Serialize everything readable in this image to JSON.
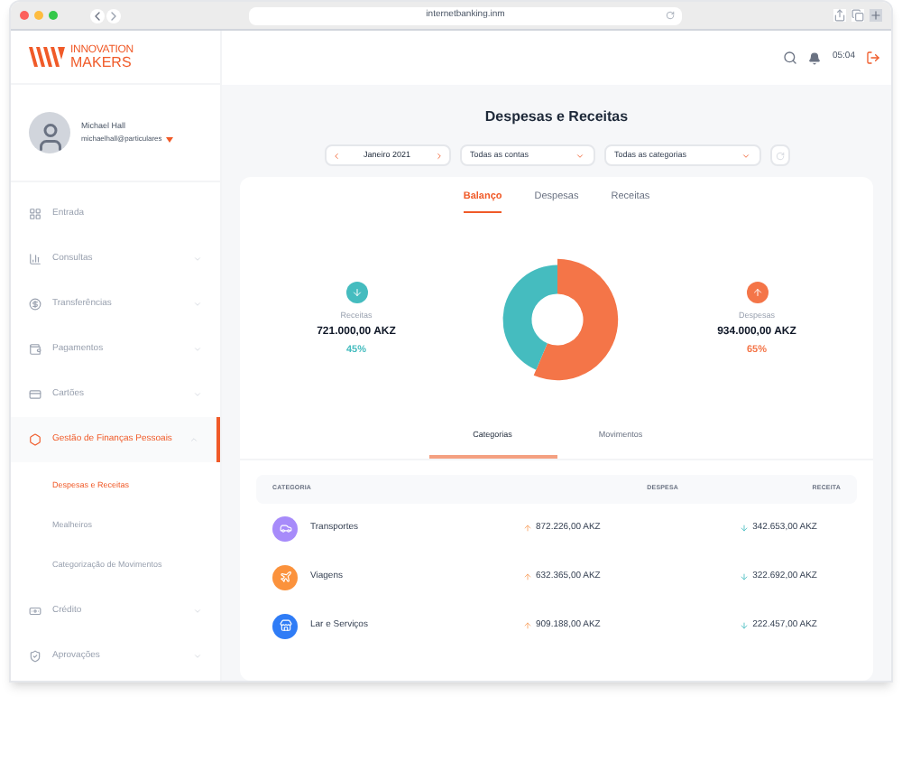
{
  "browser": {
    "url": "internetbanking.inm"
  },
  "brand": {
    "line_1": "INNOVATION",
    "line_2": "MAKERS"
  },
  "profile": {
    "name": "Michael Hall",
    "email": "michaelhall@particulares"
  },
  "sidebar": {
    "items": [
      {
        "label": "Entrada",
        "selected": false
      },
      {
        "label": "Consultas",
        "selected": false,
        "expanded": false
      },
      {
        "label": "Transferências",
        "selected": false,
        "expanded": false
      },
      {
        "label": "Pagamentos",
        "selected": false,
        "expanded": false
      },
      {
        "label": "Cartões",
        "selected": false,
        "expanded": false
      },
      {
        "label": "Gestão de Finanças Pessoais",
        "selected": true,
        "expanded": true,
        "children": [
          {
            "label": "Despesas e Receitas",
            "selected": true
          },
          {
            "label": "Mealheiros",
            "selected": false
          },
          {
            "label": "Categorização de Movimentos",
            "selected": false
          }
        ]
      },
      {
        "label": "Crédito",
        "selected": false,
        "expanded": false
      },
      {
        "label": "Aprovações",
        "selected": false,
        "expanded": false
      }
    ]
  },
  "header": {
    "time": "05:04"
  },
  "page": {
    "title": "Despesas e Receitas",
    "period": "Janeiro 2021",
    "account_filter": "Todas as contas",
    "category_filter": "Todas as categorias"
  },
  "tabs": [
    {
      "label": "Balanço",
      "selected": true
    },
    {
      "label": "Despesas",
      "selected": false
    },
    {
      "label": "Receitas",
      "selected": false
    }
  ],
  "balance": {
    "income": {
      "label": "Receitas",
      "amount": "721.000,00 AKZ",
      "percent": "45%",
      "color": "#45bcbf"
    },
    "expense": {
      "label": "Despesas",
      "amount": "934.000,00 AKZ",
      "percent": "65%",
      "color": "#f47548"
    }
  },
  "subtabs": [
    {
      "label": "Categorias",
      "selected": true
    },
    {
      "label": "Movimentos",
      "selected": false
    }
  ],
  "table": {
    "columns": [
      "CATEGORIA",
      "DESPESA",
      "RECEITA"
    ],
    "rows": [
      {
        "category": "Transportes",
        "expense": "872.226,00 AKZ",
        "income": "342.653,00 AKZ",
        "color": "#a78bfa"
      },
      {
        "category": "Viagens",
        "expense": "632.365,00 AKZ",
        "income": "322.692,00 AKZ",
        "color": "#fb923c"
      },
      {
        "category": "Lar e Serviços",
        "expense": "909.188,00 AKZ",
        "income": "222.457,00 AKZ",
        "color": "#2f7cf6"
      }
    ]
  }
}
